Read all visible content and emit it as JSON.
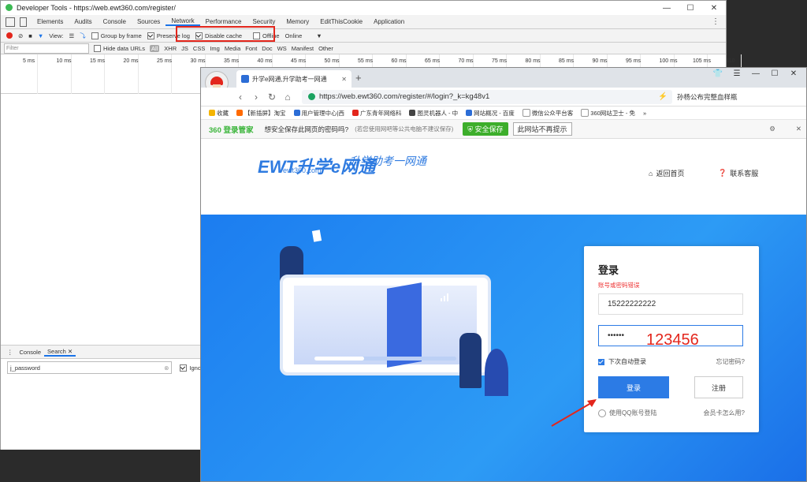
{
  "devtools": {
    "title": "Developer Tools - https://web.ewt360.com/register/",
    "tabs": [
      "Elements",
      "Audits",
      "Console",
      "Sources",
      "Network",
      "Performance",
      "Security",
      "Memory",
      "EditThisCookie",
      "Application"
    ],
    "active_tab": "Network",
    "toolbar": {
      "view_label": "View:",
      "group_by_frame": "Group by frame",
      "preserve_log": "Preserve log",
      "disable_cache": "Disable cache",
      "offline": "Offline",
      "online": "Online"
    },
    "filter": {
      "placeholder": "Filter",
      "hide_data_urls": "Hide data URLs",
      "types": [
        "All",
        "XHR",
        "JS",
        "CSS",
        "Img",
        "Media",
        "Font",
        "Doc",
        "WS",
        "Manifest",
        "Other"
      ]
    },
    "timeline_ticks": [
      "5 ms",
      "10 ms",
      "15 ms",
      "20 ms",
      "25 ms",
      "30 ms",
      "35 ms",
      "40 ms",
      "45 ms",
      "50 ms",
      "55 ms",
      "60 ms",
      "65 ms",
      "70 ms",
      "75 ms",
      "80 ms",
      "85 ms",
      "90 ms",
      "95 ms",
      "100 ms",
      "105 ms",
      "110"
    ],
    "drawer": {
      "tabs": [
        "Console",
        "Search"
      ],
      "search_query": "j_password",
      "ignore_label": "Igno"
    }
  },
  "browser": {
    "tab_title": "升学e网通,升学助考一网通",
    "url": "https://web.ewt360.com/register/#/login?_k=kg48v1",
    "url_host": "web.ewt360.com",
    "nav_right_text": "孙杨公布完整血样瓶",
    "bookmarks": [
      "收藏",
      "【新插屏】淘宝",
      "用户管理中心|西",
      "广东青年网络科",
      "图灵机器人 - 中",
      "网站概况 - 百度",
      "微信公众平台客",
      "360网站卫士 - 免"
    ],
    "bar360": {
      "logo": "360 登录管家",
      "question": "想安全保存此网页的密码吗?",
      "note": "(若您使用网吧等公共电脑不建议保存)",
      "save_btn": "安全保存",
      "never_btn": "此网站不再提示"
    }
  },
  "page": {
    "logo_text": "EWT升学e网通",
    "logo_sub": "ewt360.com",
    "slogan": "升学助考一网通",
    "home_link": "返回首页",
    "service_link": "联系客服",
    "login": {
      "title": "登录",
      "error": "账号或密码错误",
      "username": "15222222222",
      "password_mask": "••••••",
      "remember": "下次自动登录",
      "forgot": "忘记密码?",
      "login_btn": "登录",
      "register_btn": "注册",
      "qq_login": "使用QQ账号登陆",
      "member_card": "会员卡怎么用?"
    },
    "progress_fraction": 0.35
  },
  "annotation": {
    "password_hint": "123456",
    "color": "#e3261c"
  }
}
